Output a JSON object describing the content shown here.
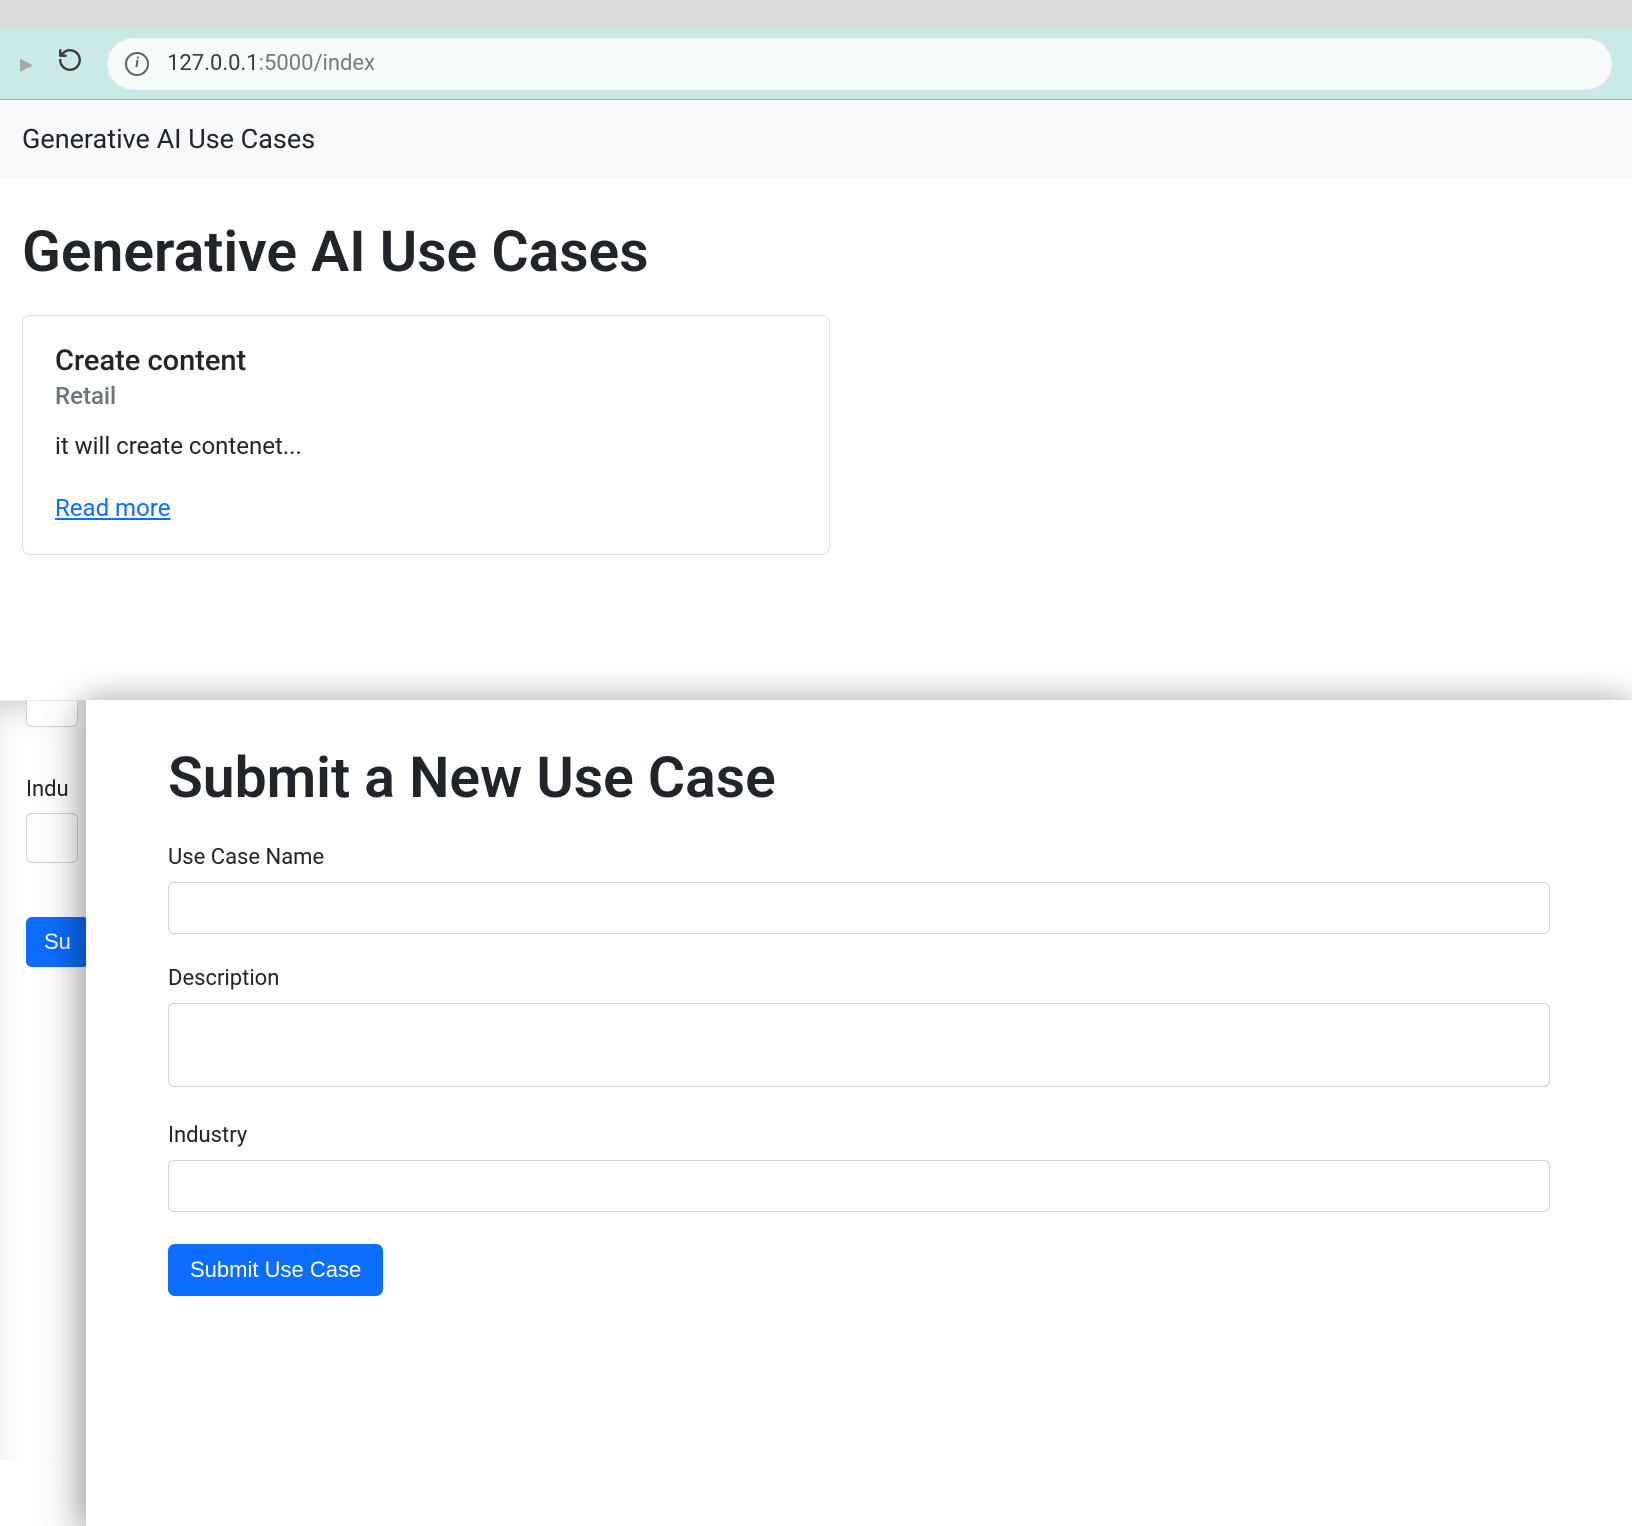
{
  "browser": {
    "url_host": "127.0.0.1",
    "url_path": ":5000/index"
  },
  "navbar": {
    "brand": "Generative AI Use Cases"
  },
  "page": {
    "title": "Generative AI Use Cases",
    "card": {
      "title": "Create content",
      "subtitle": "Retail",
      "text": "it will create contenet...",
      "link_label": "Read more"
    }
  },
  "under": {
    "industry_label_fragment": "Indu",
    "submit_fragment": "Su"
  },
  "modal": {
    "title": "Submit a New Use Case",
    "fields": {
      "name_label": "Use Case Name",
      "name_value": "",
      "description_label": "Description",
      "description_value": "",
      "industry_label": "Industry",
      "industry_value": ""
    },
    "submit_label": "Submit Use Case"
  }
}
